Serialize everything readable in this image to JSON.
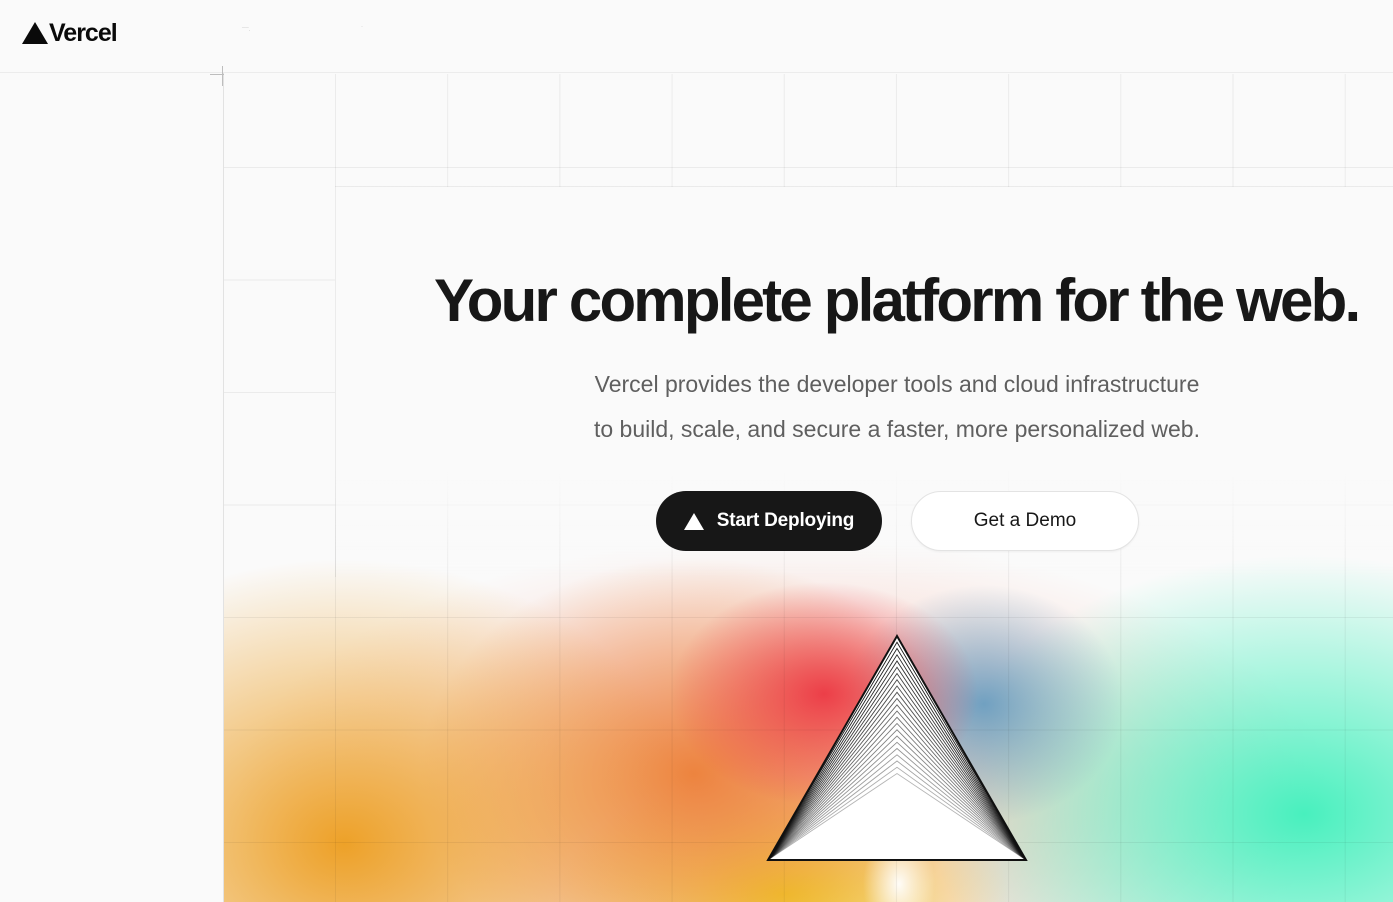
{
  "header": {
    "brand": "Vercel",
    "nav_ghost_1": "¯¯·",
    "nav_ghost_2": "·"
  },
  "hero": {
    "title": "Your complete platform for the web.",
    "subtitle_line1": "Vercel provides the developer tools and cloud infrastructure",
    "subtitle_line2": "to build, scale, and secure a faster, more personalized web."
  },
  "actions": {
    "primary_label": "Start Deploying",
    "primary_icon": "vercel-triangle-icon",
    "secondary_label": "Get a Demo"
  },
  "colors": {
    "brand": "#171717",
    "background": "#fafafa",
    "gradient_orange": "#eda128",
    "gradient_red": "#ec3844",
    "gradient_mint": "#48f0be",
    "gradient_yellow": "#f0d228"
  },
  "icons": {
    "logo": "vercel-logo-icon",
    "prism": "prism-triangle-icon"
  }
}
